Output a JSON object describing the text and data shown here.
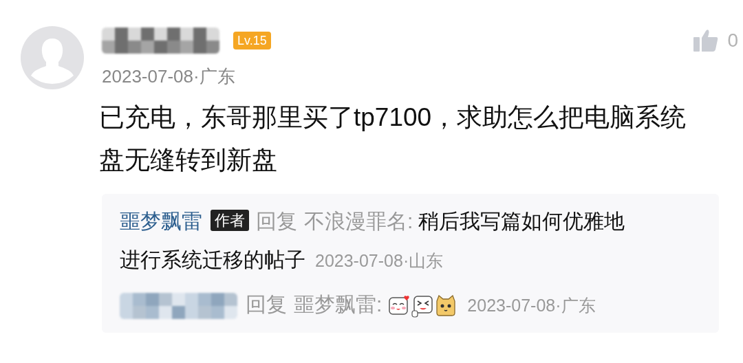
{
  "comment": {
    "level_badge": "Lv.15",
    "date": "2023-07-08·广东",
    "likes": "0",
    "text": "已充电，东哥那里买了tp7100，求助怎么把电脑系统盘无缝转到新盘"
  },
  "replies": [
    {
      "kind": "named",
      "author": "噩梦飘雷",
      "author_badge": "作者",
      "reply_word": "回复",
      "target": "不浪漫罪名:",
      "text_lines": [
        "稍后我写篇如何优雅地",
        "进行系统迁移的帖子"
      ],
      "date": "2023-07-08·山东"
    },
    {
      "kind": "blurred",
      "reply_word": "回复",
      "target": "噩梦飘雷:",
      "stickers": [
        {
          "kind": "blush"
        },
        {
          "kind": "laugh"
        },
        {
          "kind": "cat"
        }
      ],
      "date": "2023-07-08·广东"
    }
  ]
}
